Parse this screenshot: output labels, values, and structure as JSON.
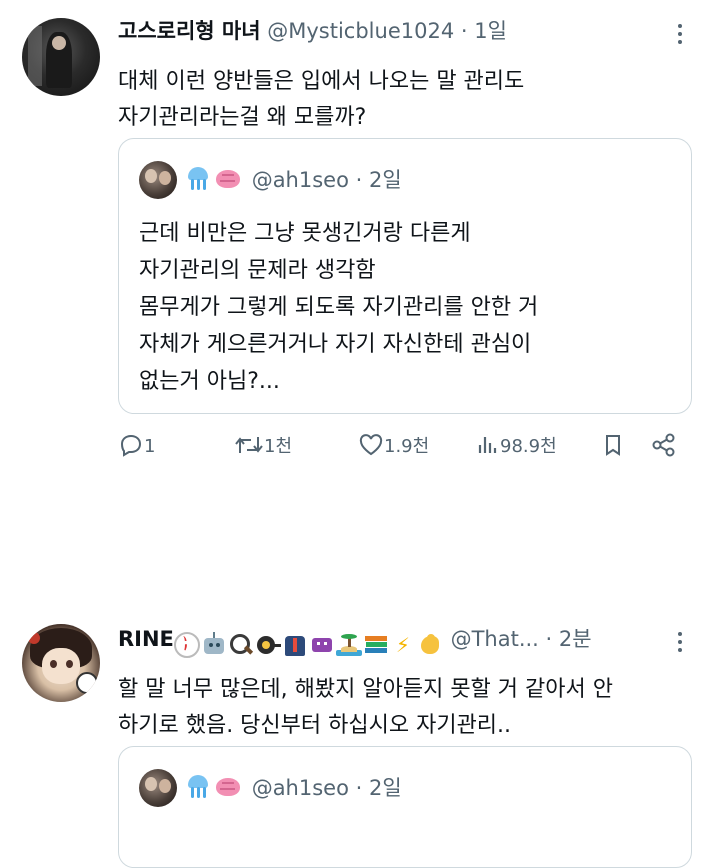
{
  "tweet1": {
    "name": "고스로리형 마녀",
    "handle": "@Mysticblue1024",
    "dot": "·",
    "time": "1일",
    "lines": [
      "대체 이런 양반들은 입에서 나오는 말 관리도",
      "자기관리라는걸 왜 모를까?"
    ],
    "quote": {
      "handle": "@ah1seo",
      "dot": "·",
      "time": "2일",
      "lines": [
        "근데 비만은 그냥 못생긴거랑 다른게",
        "자기관리의 문제라 생각함",
        "몸무게가 그렇게 되도록 자기관리를 안한 거",
        "자체가 게으른거거나 자기 자신한테 관심이",
        "없는거 아님?..."
      ]
    },
    "actions": {
      "replies": "1",
      "retweets": "1천",
      "likes": "1.9천",
      "views": "98.9천"
    }
  },
  "tweet2": {
    "name": "RINE",
    "handle": "@That...",
    "dot": "·",
    "time": "2분",
    "name_emojis": [
      "baseball",
      "robot",
      "magnifier",
      "frying-pan",
      "suit",
      "alien-monster",
      "desert-island",
      "books",
      "lightning",
      "flexed-biceps"
    ],
    "lines": [
      "할 말 너무 많은데, 해봤지 알아듣지 못할 거 같아서 안",
      "하기로 했음. 당신부터 하십시오 자기관리.."
    ],
    "quote": {
      "handle": "@ah1seo",
      "dot": "·",
      "time": "2일"
    }
  },
  "colors": {
    "text": "#0f1419",
    "secondary": "#536471",
    "border": "#cfd9de"
  }
}
